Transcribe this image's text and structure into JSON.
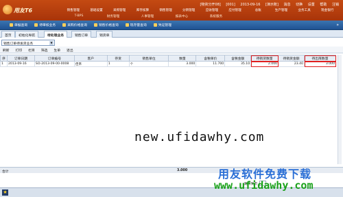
{
  "header": {
    "brand_text": "用友T6",
    "status": [
      "[物资分开08]",
      "[001]",
      "2013-09-16",
      "[演示账]",
      "消息",
      "切换",
      "设置",
      "帮助",
      "注销"
    ],
    "main_menu": [
      "销售管理",
      "基础设置",
      "采购管理",
      "库存核算",
      "销售管理",
      "分销管理",
      "应收管理",
      "应付管理",
      "总账",
      "生产管理",
      "业务工具",
      "现金银行"
    ],
    "sub_menu": [
      "T-BPS",
      "财务管理",
      "人事管理",
      "报表中心",
      "系统服务"
    ]
  },
  "shortcuts": [
    "单据查询",
    "待审核业务",
    "采购价格查询",
    "销售价格查询",
    "现存量查询",
    "凭证管理"
  ],
  "tabs": [
    "首页",
    "初始化导航",
    "待处理业务",
    "销售订单",
    "销货单"
  ],
  "filter": {
    "value": "销售订单待发货业务"
  },
  "toolbar": [
    "刷新",
    "打印",
    "栏目",
    "筛选",
    "生单",
    "退出"
  ],
  "grid": {
    "columns": [
      "序",
      "订单日期",
      "订单编号",
      "客户",
      "存货",
      "销售单位",
      "数量",
      "含税单价",
      "含税金额",
      "待销货数量",
      "待销货金额",
      "待出库数量"
    ],
    "rows": [
      [
        "1",
        "2013-09-16",
        "SO-2013-09-00-0008",
        "佳禾",
        "1",
        "个",
        "3.000",
        "11.700",
        "35.10",
        "2.000",
        "23.40",
        "3.000"
      ]
    ]
  },
  "summary": {
    "label": "合计",
    "qty": "3.000"
  },
  "pager": {
    "label": "跳转到页"
  },
  "watermark": "new.ufidawhy.com",
  "brand_overlay": "用友软件免费下载",
  "brand_url": "www.ufidawhy.com"
}
